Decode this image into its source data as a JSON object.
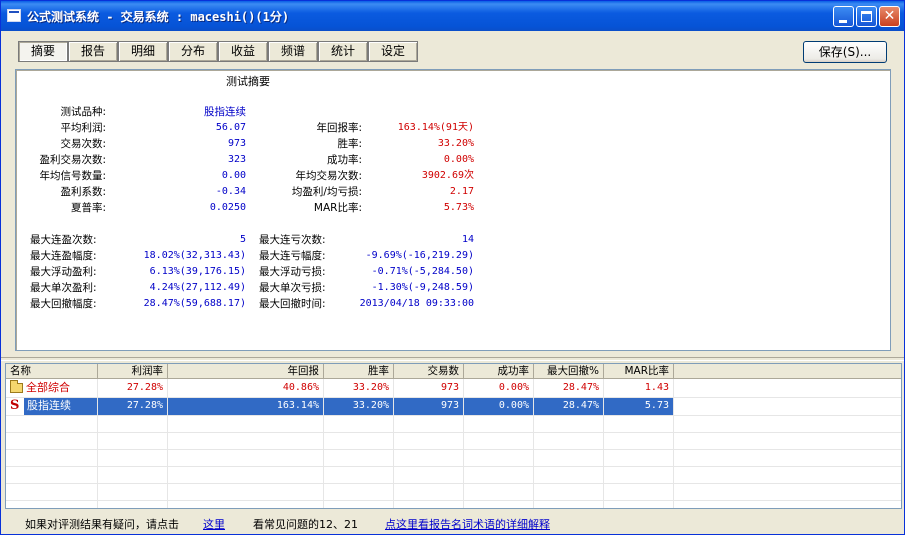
{
  "window": {
    "title": "公式测试系统 - 交易系统 : maceshi()(1分)"
  },
  "tabs": [
    {
      "label": "摘要",
      "active": true
    },
    {
      "label": "报告"
    },
    {
      "label": "明细"
    },
    {
      "label": "分布"
    },
    {
      "label": "收益"
    },
    {
      "label": "频谱"
    },
    {
      "label": "统计"
    },
    {
      "label": "设定"
    }
  ],
  "save_button": "保存(S)...",
  "summary": {
    "title": "测试摘要",
    "variety_label": "测试品种:",
    "variety_value": "股指连续",
    "left": [
      {
        "label": "平均利润:",
        "value": "56.07"
      },
      {
        "label": "交易次数:",
        "value": "973"
      },
      {
        "label": "盈利交易次数:",
        "value": "323"
      },
      {
        "label": "年均信号数量:",
        "value": "0.00"
      },
      {
        "label": "盈利系数:",
        "value": "-0.34"
      },
      {
        "label": "夏普率:",
        "value": "0.0250"
      }
    ],
    "right": [
      {
        "label": "年回报率:",
        "value": "163.14%(91天)"
      },
      {
        "label": "胜率:",
        "value": "33.20%"
      },
      {
        "label": "成功率:",
        "value": "0.00%"
      },
      {
        "label": "年均交易次数:",
        "value": "3902.69次"
      },
      {
        "label": "均盈利/均亏损:",
        "value": "2.17"
      },
      {
        "label": "MAR比率:",
        "value": "5.73%"
      }
    ],
    "left2": [
      {
        "label": "最大连盈次数:",
        "value": "5"
      },
      {
        "label": "最大连盈幅度:",
        "value": "18.02%(32,313.43)"
      },
      {
        "label": "最大浮动盈利:",
        "value": "6.13%(39,176.15)"
      },
      {
        "label": "最大单次盈利:",
        "value": "4.24%(27,112.49)"
      },
      {
        "label": "最大回撤幅度:",
        "value": "28.47%(59,688.17)"
      }
    ],
    "right2": [
      {
        "label": "最大连亏次数:",
        "value": "14"
      },
      {
        "label": "最大连亏幅度:",
        "value": "-9.69%(-16,219.29)"
      },
      {
        "label": "最大浮动亏损:",
        "value": "-0.71%(-5,284.50)"
      },
      {
        "label": "最大单次亏损:",
        "value": "-1.30%(-9,248.59)"
      },
      {
        "label": "最大回撤时间:",
        "value": "2013/04/18 09:33:00"
      }
    ]
  },
  "table": {
    "columns": [
      "名称",
      "利润率",
      "年回报",
      "胜率",
      "交易数",
      "成功率",
      "最大回撤%",
      "MAR比率"
    ],
    "rows": [
      {
        "icon": "folder-icon",
        "cells": [
          "全部综合",
          "27.28%",
          "40.86%",
          "33.20%",
          "973",
          "0.00%",
          "28.47%",
          "1.43"
        ]
      },
      {
        "icon": "s-icon",
        "icon_text": "S",
        "selected": true,
        "cells": [
          "股指连续",
          "27.28%",
          "163.14%",
          "33.20%",
          "973",
          "0.00%",
          "28.47%",
          "5.73"
        ]
      }
    ]
  },
  "footer": {
    "text1": "如果对评测结果有疑问，请点击",
    "link1": "这里",
    "text2": "看常见问题的12、21",
    "link2": "点这里看报告名词术语的详细解释"
  },
  "colors": {
    "value_blue": "#0000C8",
    "value_red": "#D00000",
    "selection": "#316AC5",
    "titlebar": "#0A5FE6"
  }
}
